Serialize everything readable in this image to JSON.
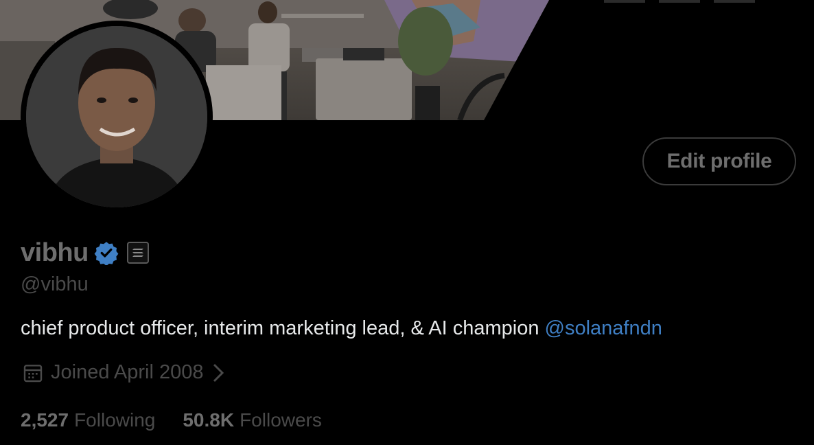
{
  "profile": {
    "display_name": "vibhu",
    "handle": "@vibhu",
    "verified_badge_icon": "verified-badge-icon",
    "affiliate_icon": "affiliate-org-icon",
    "bio_text": "chief product officer, interim marketing lead, & AI champion ",
    "bio_mention": "@solanafndn",
    "joined_text": "Joined April 2008",
    "edit_button_label": "Edit profile"
  },
  "stats": {
    "following_count": "2,527",
    "following_label": "Following",
    "followers_count": "50.8K",
    "followers_label": "Followers"
  },
  "colors": {
    "background": "#000000",
    "mention": "#3f7fc4",
    "verified": "#3f7fc4",
    "muted_text": "#4a4a4a",
    "bio_text": "#e7e9ea"
  }
}
